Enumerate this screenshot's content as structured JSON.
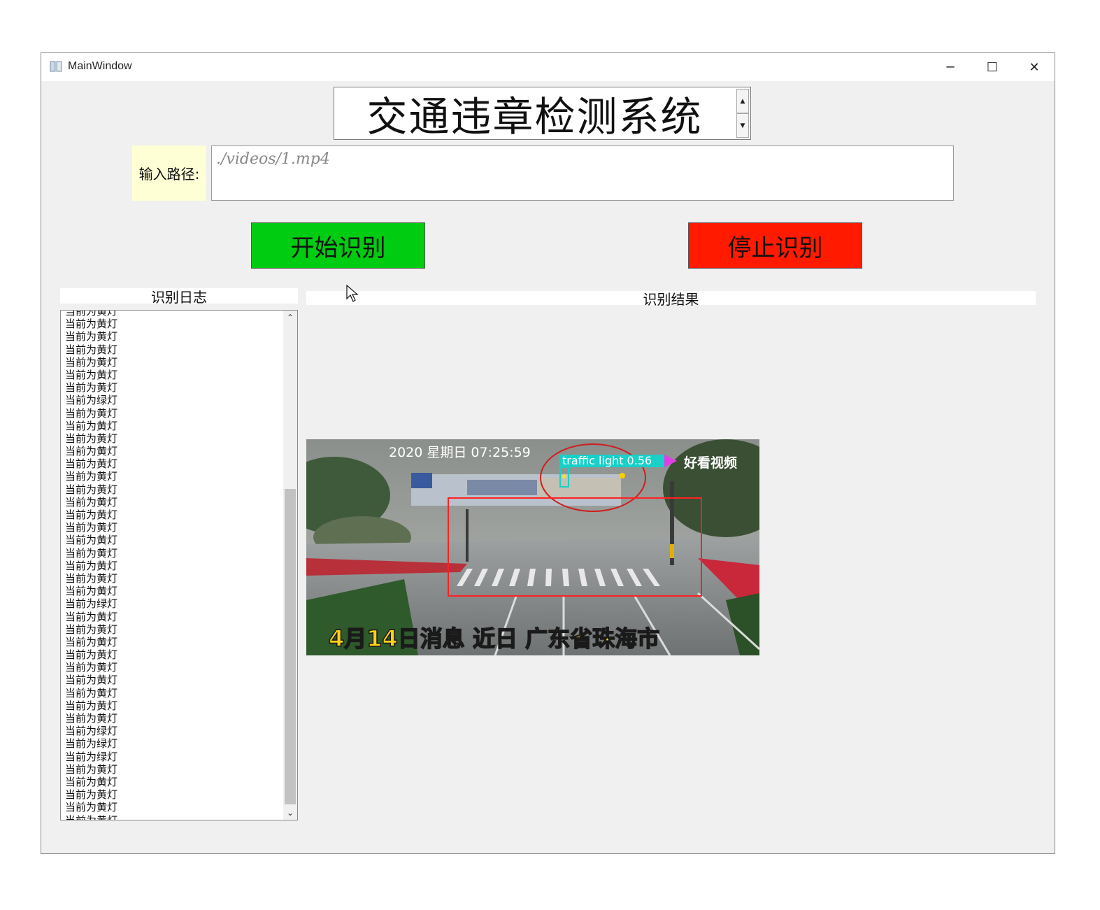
{
  "window": {
    "title": "MainWindow",
    "min": "─",
    "max": "☐",
    "close": "✕"
  },
  "header": {
    "title": "交通违章检测系统",
    "spin_up": "▲",
    "spin_down": "▼"
  },
  "path": {
    "label": "输入路径:",
    "value": "./videos/1.mp4"
  },
  "buttons": {
    "start": "开始识别",
    "stop": "停止识别"
  },
  "log": {
    "header": "识别日志",
    "items": [
      "当前为黄灯",
      "当前为黄灯",
      "当前为黄灯",
      "当前为黄灯",
      "当前为黄灯",
      "当前为黄灯",
      "当前为黄灯",
      "当前为绿灯",
      "当前为黄灯",
      "当前为黄灯",
      "当前为黄灯",
      "当前为黄灯",
      "当前为黄灯",
      "当前为黄灯",
      "当前为黄灯",
      "当前为黄灯",
      "当前为黄灯",
      "当前为黄灯",
      "当前为黄灯",
      "当前为黄灯",
      "当前为黄灯",
      "当前为黄灯",
      "当前为黄灯",
      "当前为绿灯",
      "当前为黄灯",
      "当前为黄灯",
      "当前为黄灯",
      "当前为黄灯",
      "当前为黄灯",
      "当前为黄灯",
      "当前为黄灯",
      "当前为黄灯",
      "当前为黄灯",
      "当前为绿灯",
      "当前为绿灯",
      "当前为绿灯",
      "当前为黄灯",
      "当前为黄灯",
      "当前为黄灯",
      "当前为黄灯",
      "当前为黄灯"
    ],
    "scroll_position": 0.35
  },
  "result": {
    "header": "识别结果",
    "overlay_date": "2020 星期日 07:25:59",
    "detection_label": "traffic light 0.56",
    "watermark": "好看视频",
    "caption": "4月14日消息 近日 广东省珠海市"
  },
  "colors": {
    "start": "#00cc11",
    "stop": "#ff1a00",
    "label_bg": "#ffffd6",
    "detect_box": "#ff2222"
  }
}
